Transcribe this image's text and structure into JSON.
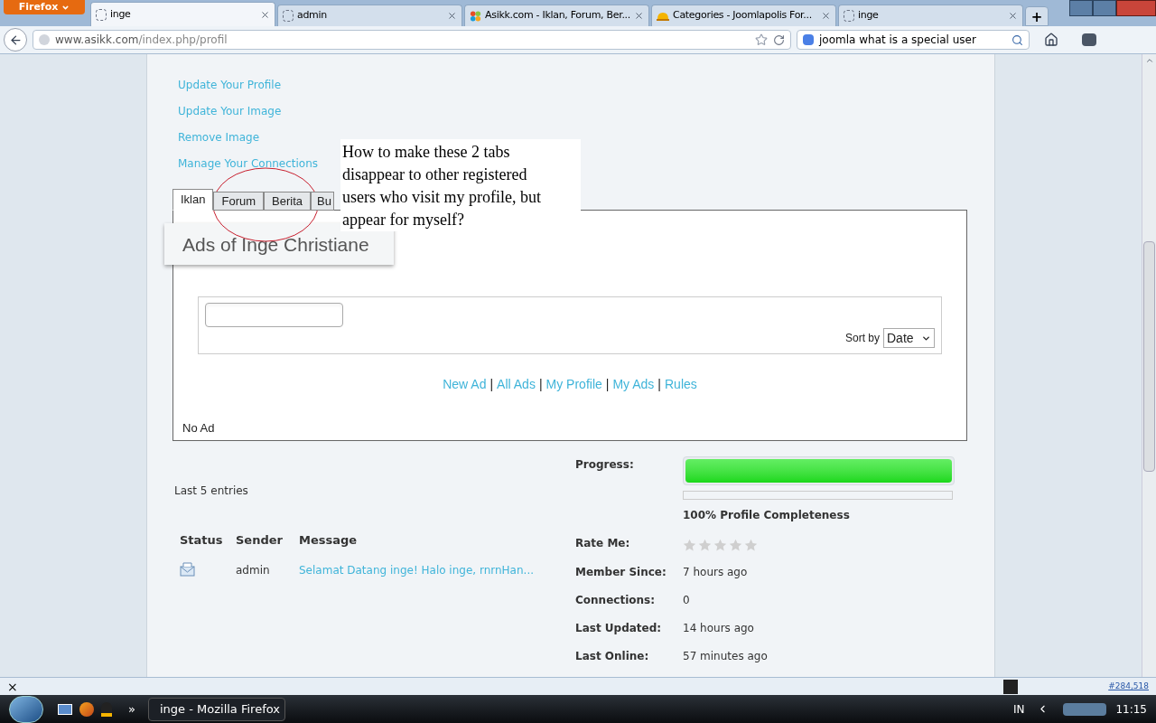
{
  "browser": {
    "menu_button": "Firefox",
    "tabs": [
      {
        "title": "inge",
        "selected": true,
        "kind": "blank"
      },
      {
        "title": "admin",
        "selected": false,
        "kind": "blank"
      },
      {
        "title": "Asikk.com - Iklan, Forum, Ber...",
        "selected": false,
        "kind": "joomla"
      },
      {
        "title": "Categories - Joomlapolis For...",
        "selected": false,
        "kind": "hat"
      },
      {
        "title": "inge",
        "selected": false,
        "kind": "blank"
      }
    ],
    "new_tab": "+",
    "url": {
      "domain": "www.asikk.com",
      "path": "/index.php/profil"
    },
    "search": "joomla what is a special user"
  },
  "profile_links": [
    "Update Your Profile",
    "Update Your Image",
    "Remove Image",
    "Manage Your Connections"
  ],
  "profile_tabs": [
    {
      "label": "Iklan",
      "selected": true
    },
    {
      "label": "Forum",
      "selected": false
    },
    {
      "label": "Berita",
      "selected": false
    },
    {
      "label": "Bu",
      "selected": false
    }
  ],
  "ads": {
    "heading": "Ads of Inge Christiane",
    "sort_label": "Sort by",
    "sort_value": "Date",
    "nav_links": [
      "New Ad",
      "All Ads",
      "My Profile",
      "My Ads",
      "Rules"
    ],
    "separator": "|",
    "empty": "No Ad"
  },
  "messages": {
    "title": "Last 5 entries",
    "columns": [
      "Status",
      "Sender",
      "Message"
    ],
    "rows": [
      {
        "sender": "admin",
        "message": "Selamat Datang inge! Halo inge, rnrnHan..."
      }
    ]
  },
  "stats": {
    "progress_label": "Progress:",
    "level": 1,
    "completeness": "100% Profile Completeness",
    "rate_label": "Rate Me:",
    "stars": 0,
    "fields": [
      {
        "label": "Member Since:",
        "value": "7 hours ago"
      },
      {
        "label": "Connections:",
        "value": "0"
      },
      {
        "label": "Last Updated:",
        "value": "14 hours ago"
      },
      {
        "label": "Last Online:",
        "value": "57 minutes ago"
      }
    ]
  },
  "annotation": "How to make these 2 tabs disappear to other registered users who visit my profile, but appear for myself?",
  "addon_bar": {
    "close": "×",
    "counter": "#284,518"
  },
  "taskbar": {
    "window": "inge - Mozilla Firefox",
    "more": "»",
    "language": "IN",
    "time": "11:15"
  }
}
